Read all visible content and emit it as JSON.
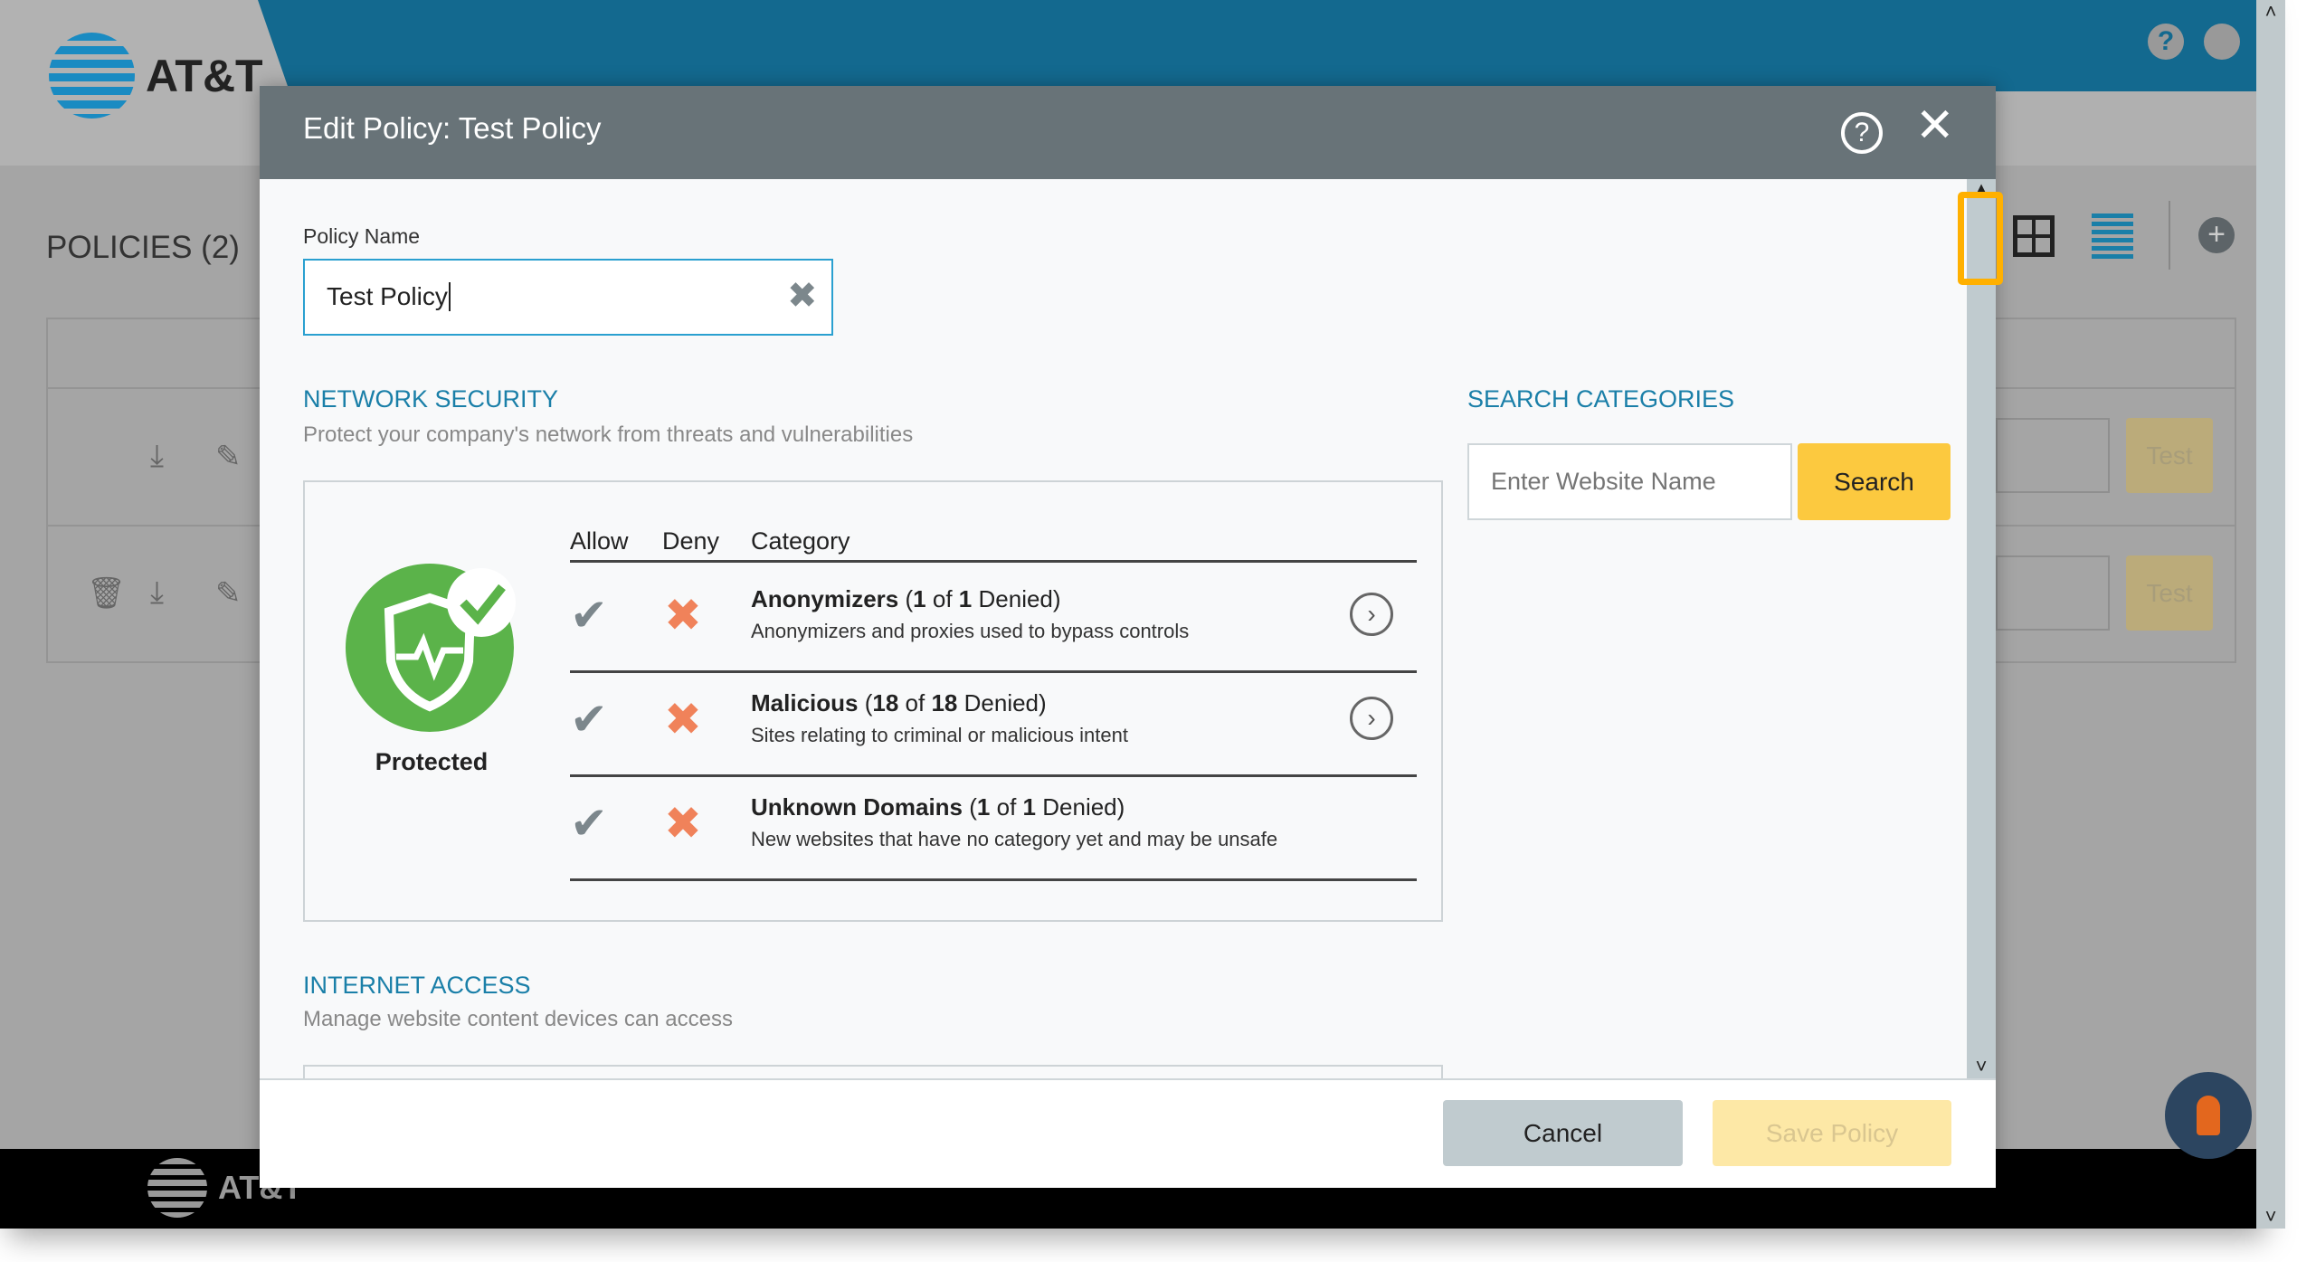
{
  "app": {
    "brand": "AT&T",
    "page_title": "POLICIES (2)",
    "test_label": "Test"
  },
  "modal": {
    "title": "Edit Policy: Test Policy",
    "policy_name_label": "Policy Name",
    "policy_name_value": "Test Policy",
    "network_security": {
      "title": "NETWORK SECURITY",
      "description": "Protect your company's network from threats and vulnerabilities",
      "status": "Protected",
      "columns": [
        "Allow",
        "Deny",
        "Category"
      ],
      "rows": [
        {
          "name": "Anonymizers",
          "denied": "1",
          "total": "1",
          "of": "of",
          "denied_label": "Denied)",
          "open": "(",
          "description": "Anonymizers and proxies used to bypass controls",
          "has_details": true
        },
        {
          "name": "Malicious",
          "denied": "18",
          "total": "18",
          "of": "of",
          "denied_label": "Denied)",
          "open": "(",
          "description": "Sites relating to criminal or malicious intent",
          "has_details": true
        },
        {
          "name": "Unknown Domains",
          "denied": "1",
          "total": "1",
          "of": "of",
          "denied_label": "Denied)",
          "open": "(",
          "description": "New websites that have no category yet and may be unsafe",
          "has_details": false
        }
      ]
    },
    "search": {
      "title": "SEARCH CATEGORIES",
      "placeholder": "Enter Website Name",
      "button": "Search"
    },
    "internet_access": {
      "title": "INTERNET ACCESS",
      "description": "Manage website content devices can access"
    },
    "cancel": "Cancel",
    "save": "Save Policy"
  },
  "colors": {
    "accent": "#1a7fa8",
    "header": "#13698f",
    "deny": "#f0825a",
    "search_button": "#fcc93f",
    "highlight": "#ffb000",
    "protected": "#5bb34a"
  }
}
